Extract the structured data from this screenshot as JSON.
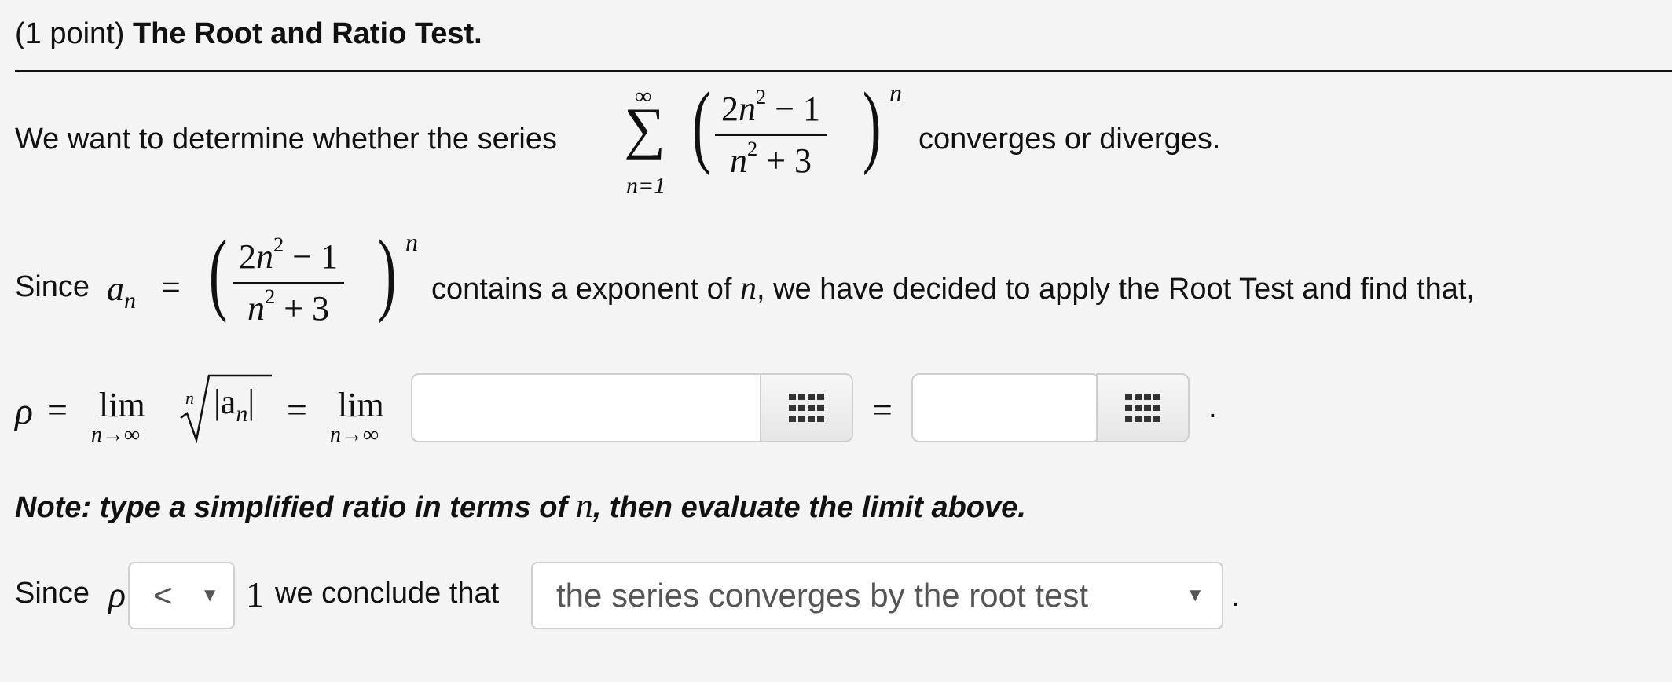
{
  "header": {
    "points": "(1 point)",
    "title": "The Root and Ratio Test."
  },
  "paragraph1": {
    "prefix": "We want to determine whether the series",
    "suffix": "converges or diverges.",
    "sum_upper": "∞",
    "sum_lower": "n=1",
    "sum_symbol": "∑",
    "numerator": "2n² − 1",
    "denominator": "n² + 3",
    "exponent": "n"
  },
  "paragraph2": {
    "prefix": "Since",
    "var": "a",
    "sub": "n",
    "equals": "=",
    "numerator": "2n² − 1",
    "denominator": "n² + 3",
    "exponent": "n",
    "text_a": "contains a exponent of",
    "text_var": "n",
    "text_b": ", we have decided to apply the Root Test and find that,"
  },
  "limit_line": {
    "rho": "ρ",
    "equals": "=",
    "lim": "lim",
    "lim_sub": "n→∞",
    "root_index": "n",
    "root_content": "|a",
    "root_sub": "n",
    "root_close": "|",
    "equals2": "=",
    "lim2": "lim",
    "lim_sub2": "n→∞",
    "equals3": "=",
    "period": ".",
    "input1_value": "",
    "input2_value": ""
  },
  "note": {
    "text_a": "Note: type a simplified ratio in terms of",
    "var": "n",
    "text_b": ", then evaluate the limit above."
  },
  "conclusion": {
    "prefix": "Since",
    "rho": "ρ",
    "comparison_selected": "<",
    "one": "1",
    "middle": "we conclude that",
    "conclusion_selected": "the series converges by the root test",
    "period": "."
  },
  "icons": {
    "grid": "keypad-grid-icon",
    "dropdown": "triangle-down-icon"
  }
}
